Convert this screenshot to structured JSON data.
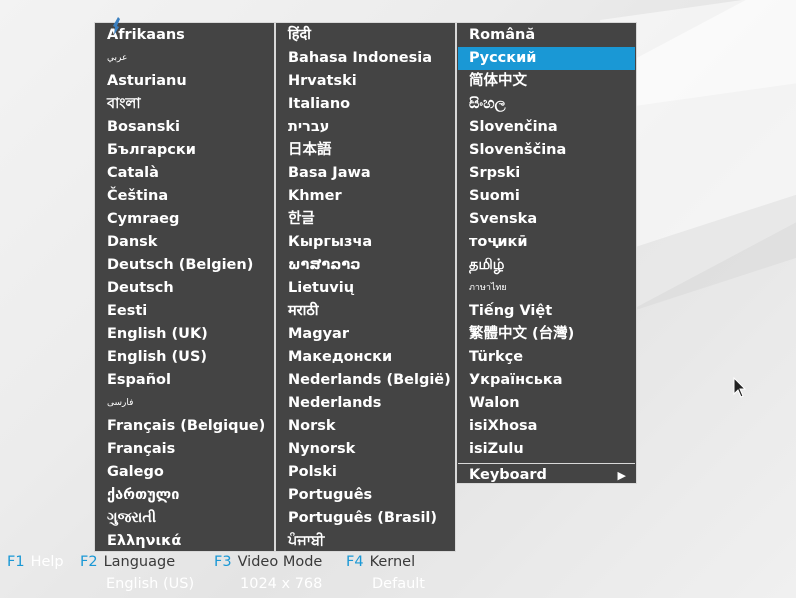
{
  "languages": {
    "column1": [
      "Afrikaans",
      "عربي",
      "Asturianu",
      "বাংলা",
      "Bosanski",
      "Български",
      "Català",
      "Čeština",
      "Cymraeg",
      "Dansk",
      "Deutsch (Belgien)",
      "Deutsch",
      "Eesti",
      "English (UK)",
      "English (US)",
      "Español",
      "فارسی",
      "Français (Belgique)",
      "Français",
      "Galego",
      "ქართული",
      "ગુજરાતી",
      "Ελληνικά"
    ],
    "column2": [
      "हिंदी",
      "Bahasa Indonesia",
      "Hrvatski",
      "Italiano",
      "עברית",
      "日本語",
      "Basa Jawa",
      "Khmer",
      "한글",
      "Кыргызча",
      "ພາສາລາວ",
      "Lietuvių",
      "मराठी",
      "Magyar",
      "Македонски",
      "Nederlands (België)",
      "Nederlands",
      "Norsk",
      "Nynorsk",
      "Polski",
      "Português",
      "Português (Brasil)",
      "ਪੰਜਾਬੀ"
    ],
    "column3": [
      "Română",
      "Русский",
      "简体中文",
      "සිංහල",
      "Slovenčina",
      "Slovenščina",
      "Srpski",
      "Suomi",
      "Svenska",
      "тоҷикӣ",
      "தமிழ்",
      "ภาษาไทย",
      "Tiếng Việt",
      "繁體中文 (台灣)",
      "Türkçe",
      "Українська",
      "Walon",
      "isiXhosa",
      "isiZulu"
    ],
    "selected": "Русский",
    "keyboard_label": "Keyboard",
    "keyboard_arrow": "▶"
  },
  "function_keys": [
    {
      "key": "F1",
      "label": "Help",
      "value": ""
    },
    {
      "key": "F2",
      "label": "Language",
      "value": "English (US)"
    },
    {
      "key": "F3",
      "label": "Video Mode",
      "value": "1024 x 768"
    },
    {
      "key": "F4",
      "label": "Kernel",
      "value": "Default"
    }
  ],
  "colors": {
    "menu_bg": "#444444",
    "menu_border": "#d8d8d8",
    "highlight": "#1a98d5",
    "fkey": "#1a98d5"
  }
}
